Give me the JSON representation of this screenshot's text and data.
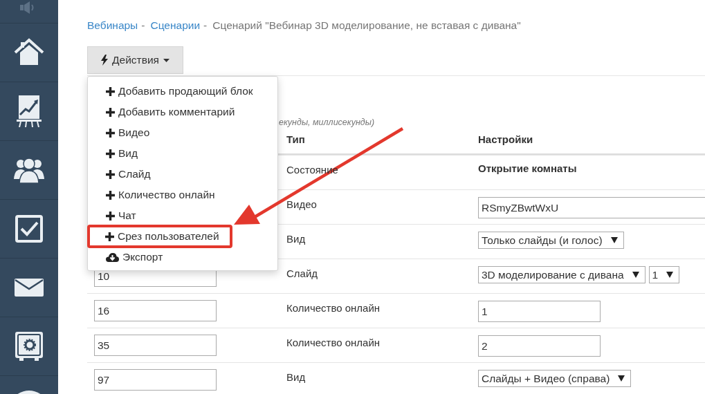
{
  "breadcrumb": [
    {
      "label": "Вебинары",
      "link": true,
      "separator": "-"
    },
    {
      "label": "Сценарии",
      "link": true,
      "separator": "-"
    },
    {
      "label": "Сценарий \"Вебинар 3D моделирование, не вставая с дивана\"",
      "link": false
    }
  ],
  "actions_button": {
    "label": "Действия"
  },
  "actions_menu": {
    "items": [
      {
        "label": "Добавить продающий блок",
        "kind": "plus",
        "highlighted": false
      },
      {
        "label": "Добавить комментарий",
        "kind": "plus",
        "highlighted": false
      },
      {
        "label": "Видео",
        "kind": "plus",
        "highlighted": false
      },
      {
        "label": "Вид",
        "kind": "plus",
        "highlighted": false
      },
      {
        "label": "Слайд",
        "kind": "plus",
        "highlighted": false
      },
      {
        "label": "Количество онлайн",
        "kind": "plus",
        "highlighted": false
      },
      {
        "label": "Чат",
        "kind": "plus",
        "highlighted": false
      },
      {
        "label": "Срез пользователей",
        "kind": "plus",
        "highlighted": true
      },
      {
        "label": "Экспорт",
        "kind": "download",
        "highlighted": false
      }
    ]
  },
  "hint": "екунды, миллисекунды)",
  "table": {
    "columns": [
      "Тип",
      "Настройки"
    ],
    "rows": [
      {
        "type": "Состояние",
        "setting": {
          "kind": "text",
          "value": "Открытие комнаты"
        }
      },
      {
        "type": "Видео",
        "setting": {
          "kind": "input_wide",
          "value": "RSmyZBwtWxU"
        }
      },
      {
        "type": "Вид",
        "setting": {
          "kind": "select",
          "values": [
            "Только слайды (и голос)"
          ]
        }
      },
      {
        "time": "10",
        "type": "Слайд",
        "setting": {
          "kind": "select",
          "values": [
            "3D моделирование с дивана",
            "1"
          ]
        }
      },
      {
        "time": "16",
        "type": "Количество онлайн",
        "setting": {
          "kind": "input",
          "value": "1"
        }
      },
      {
        "time": "35",
        "type": "Количество онлайн",
        "setting": {
          "kind": "input",
          "value": "2"
        }
      },
      {
        "time": "97",
        "type": "Вид",
        "setting": {
          "kind": "select",
          "values": [
            "Слайды + Видео (справа)"
          ]
        }
      }
    ]
  }
}
